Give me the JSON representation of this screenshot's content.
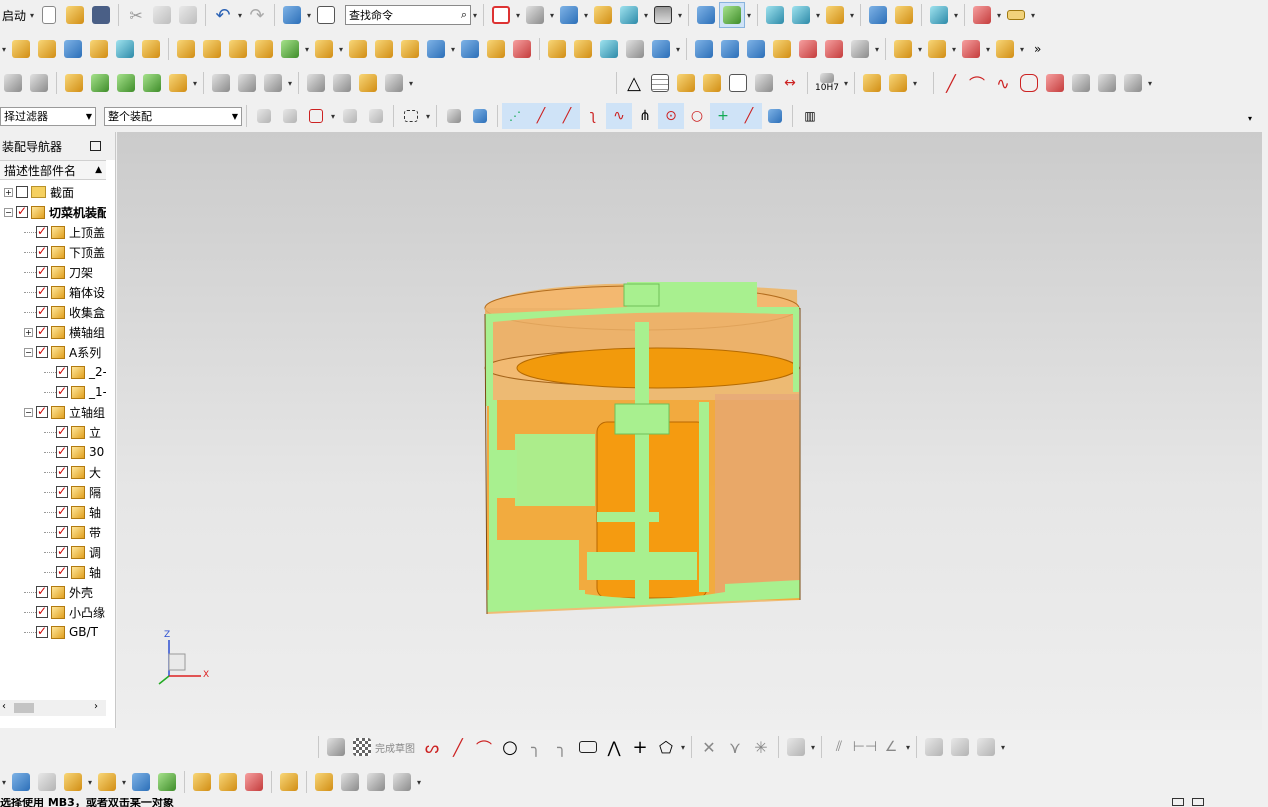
{
  "toolbar_row1": {
    "start_menu": "启动",
    "search_placeholder": "查找命令"
  },
  "selection_bar": {
    "filter_value": "择过滤器",
    "scope_value": "整个装配"
  },
  "navigator": {
    "title": "装配导航器",
    "column_header": "描述性部件名",
    "items": [
      {
        "label": "截面",
        "checked": false,
        "icon": "folder-icon",
        "level": 0
      },
      {
        "label": "切菜机装配",
        "checked": true,
        "icon": "assembly-icon",
        "level": 0
      },
      {
        "label": "上顶盖",
        "checked": true,
        "icon": "part-icon",
        "level": 1
      },
      {
        "label": "下顶盖",
        "checked": true,
        "icon": "part-icon",
        "level": 1
      },
      {
        "label": "刀架",
        "checked": true,
        "icon": "part-icon",
        "level": 1
      },
      {
        "label": "箱体设",
        "checked": true,
        "icon": "part-icon",
        "level": 1
      },
      {
        "label": "收集盒",
        "checked": true,
        "icon": "part-icon",
        "level": 1
      },
      {
        "label": "横轴组",
        "checked": true,
        "icon": "assembly-icon",
        "level": 1
      },
      {
        "label": "A系列",
        "checked": true,
        "icon": "assembly-icon",
        "level": 1
      },
      {
        "label": "_2-",
        "checked": true,
        "icon": "part-icon",
        "level": 2
      },
      {
        "label": "_1-",
        "checked": true,
        "icon": "part-icon",
        "level": 2
      },
      {
        "label": "立轴组",
        "checked": true,
        "icon": "assembly-icon",
        "level": 1
      },
      {
        "label": "立",
        "checked": true,
        "icon": "part-icon",
        "level": 2
      },
      {
        "label": "30",
        "checked": true,
        "icon": "part-icon",
        "level": 2
      },
      {
        "label": "大",
        "checked": true,
        "icon": "part-icon",
        "level": 2
      },
      {
        "label": "隔",
        "checked": true,
        "icon": "part-icon",
        "level": 2
      },
      {
        "label": "轴",
        "checked": true,
        "icon": "part-icon",
        "level": 2
      },
      {
        "label": "带",
        "checked": true,
        "icon": "part-icon",
        "level": 2
      },
      {
        "label": "调",
        "checked": true,
        "icon": "part-icon",
        "level": 2
      },
      {
        "label": "轴",
        "checked": true,
        "icon": "part-icon",
        "level": 2
      },
      {
        "label": "外壳",
        "checked": true,
        "icon": "part-icon",
        "level": 1
      },
      {
        "label": "小凸缘",
        "checked": true,
        "icon": "part-icon",
        "level": 1
      },
      {
        "label": "GB/T",
        "checked": true,
        "icon": "part-icon",
        "level": 1
      }
    ]
  },
  "viewport": {
    "triad_z": "Z",
    "triad_x": "X"
  },
  "sketch_toolbar": {
    "finish_sketch": "完成草图"
  },
  "toolbar_misc": {
    "fit_label": "10H7"
  },
  "status": {
    "message": "选择使用 MB3，或者双击某一对象"
  },
  "colors": {
    "shell": "#e39a1c",
    "section": "#a8f08f",
    "viewport_top": "#cbcbcb",
    "viewport_bottom": "#eeeeee"
  }
}
